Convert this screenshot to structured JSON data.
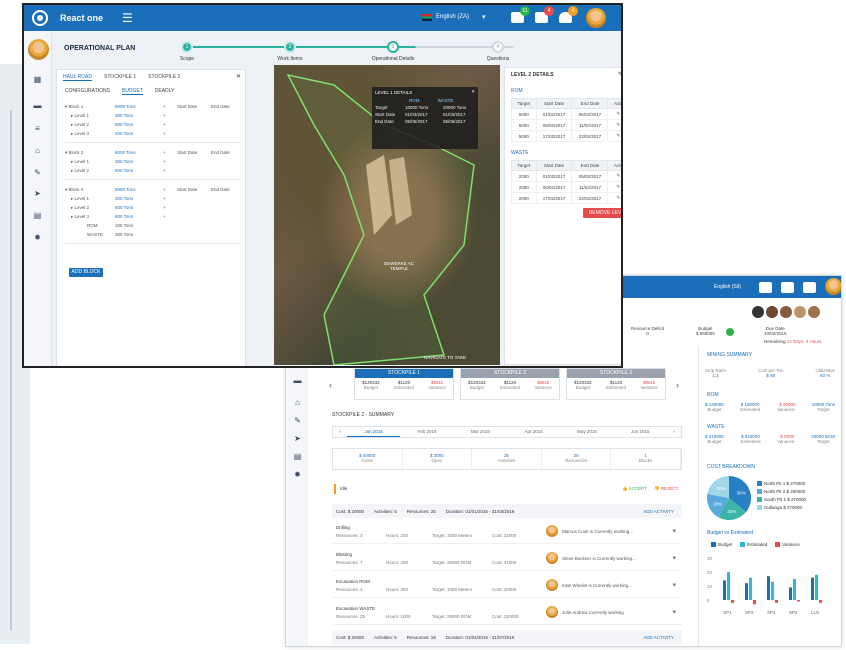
{
  "front": {
    "app_name": "React one",
    "language": "English (ZA)",
    "notifications": [
      {
        "icon": "mail-icon",
        "count": "11",
        "color": "#2bb34b"
      },
      {
        "icon": "chat-icon",
        "count": "4",
        "color": "#e64b4b"
      },
      {
        "icon": "bell-icon",
        "count": "4",
        "color": "#f0a020"
      }
    ],
    "page_title": "OPERATIONAL PLAN",
    "steps": [
      {
        "num": "1",
        "label": "Scope"
      },
      {
        "num": "2",
        "label": "Work Items"
      },
      {
        "num": "3",
        "label": "Operational Details"
      },
      {
        "num": "4",
        "label": "Questions"
      }
    ],
    "left_tabs": [
      "HAUL ROAD",
      "STOCKPILE 1",
      "STOCKPILE 2"
    ],
    "sub_tabs": [
      "CONFIGURATIONS",
      "BUDGET",
      "DEADLY"
    ],
    "blocks": [
      {
        "name": "Block 1",
        "amount": "9000 Tons",
        "start": "Start Date",
        "end": "End Date",
        "levels": [
          {
            "name": "Level 1",
            "amount": "300 Tons"
          },
          {
            "name": "Level 2",
            "amount": "600 Tons"
          },
          {
            "name": "Level 3",
            "amount": "400 Tons"
          }
        ]
      },
      {
        "name": "Block 2",
        "amount": "8000 Tons",
        "start": "Start Date",
        "end": "End Date",
        "levels": [
          {
            "name": "Level 1",
            "amount": "300 Tons"
          },
          {
            "name": "Level 2",
            "amount": "600 Tons"
          }
        ]
      },
      {
        "name": "Block 3",
        "amount": "8000 Tons",
        "start": "Start Date",
        "end": "End Date",
        "levels": [
          {
            "name": "Level 1",
            "amount": "300 Tons"
          },
          {
            "name": "Level 2",
            "amount": "600 Tons"
          },
          {
            "name": "Level 3",
            "amount": "600 Tons"
          }
        ]
      }
    ],
    "sub_levels": [
      {
        "name": "ROM",
        "amount": "100 Tons"
      },
      {
        "name": "WASTE",
        "amount": "300 Tons"
      }
    ],
    "add_block_label": "ADD BLOCK",
    "map": {
      "popup_title": "LEVEL 1 DETAILS",
      "popup_cols": [
        "ROM",
        "WASTE"
      ],
      "popup_rows": [
        {
          "label": "Target",
          "rom": "10000 Tons",
          "waste": "20000 Tons"
        },
        {
          "label": "Start Date",
          "rom": "01/03/2017",
          "waste": "01/03/2017"
        },
        {
          "label": "End Date",
          "rom": "05/05/2017",
          "waste": "05/05/2017"
        }
      ],
      "area_label": "DEWERKE AC",
      "area_sub": "TEMPLE",
      "bottom_label": "NAVIGATE TO TAKE"
    },
    "level_details": {
      "title": "LEVEL 2 DETAILS",
      "rom_label": "ROM",
      "waste_label": "WASTE",
      "headers": [
        "Target",
        "Start Date",
        "End Date",
        "Action"
      ],
      "rom_rows": [
        [
          "5000",
          "01/02/2017",
          "05/02/2017"
        ],
        [
          "5000",
          "06/02/2017",
          "11/02/2017"
        ],
        [
          "5000",
          "17/02/2017",
          "22/02/2017"
        ]
      ],
      "waste_rows": [
        [
          "2000",
          "01/02/2017",
          "05/02/2017"
        ],
        [
          "2000",
          "06/02/2017",
          "11/02/2017"
        ],
        [
          "2000",
          "17/02/2017",
          "22/02/2017"
        ]
      ],
      "remove_label": "REMOVE LEVEL"
    }
  },
  "back": {
    "language": "English (Sit)",
    "kpis": [
      {
        "label": "Resource Deficit",
        "value": "0"
      },
      {
        "label": "Budget",
        "value": "$ 550000"
      },
      {
        "label": "Due Date",
        "value": "10/02/2016"
      },
      {
        "label": "Remaining",
        "value": "12 Days, 4 Hours"
      }
    ],
    "stockpiles": [
      {
        "name": "STOCKPILE 1",
        "color": "#1b6fb8",
        "budget": "$120332",
        "estimated": "$1120",
        "variance": "$961k"
      },
      {
        "name": "STOCKPILE 2",
        "color": "#9aa3ad",
        "budget": "$120332",
        "estimated": "$1120",
        "variance": "$961k"
      },
      {
        "name": "STOCKPILE 3",
        "color": "#9aa3ad",
        "budget": "$120332",
        "estimated": "$1120",
        "variance": "$961k"
      }
    ],
    "stock_value_labels": [
      "Budget",
      "Estimated",
      "Variance"
    ],
    "summary_title": "STOCKPILE 2 - SUMMARY",
    "months": [
      "Jan 2015",
      "Feb 2015",
      "Mar 2015",
      "Apr 2015",
      "May 2015",
      "Jun 2015"
    ],
    "summary_stats": [
      {
        "value": "$ 40000",
        "label": "Costs"
      },
      {
        "value": "$ 3000",
        "label": "Opex"
      },
      {
        "value": "35",
        "label": "Activities"
      },
      {
        "value": "25",
        "label": "Resources"
      },
      {
        "value": "1",
        "label": "Blocks"
      }
    ],
    "state_label": "Idle",
    "approve_label": "ACCEPT",
    "reject_label": "REJECT",
    "cost_bar": {
      "cost": "Cost: $ 20000",
      "activities": "Activities: 5",
      "resources": "Resources: 25",
      "duration": "Duration: 01/01/2016 - 31/03/2016",
      "add": "ADD ACTIVITY"
    },
    "activities": [
      {
        "name": "Drilling",
        "res": "Resources: 3",
        "hours": "Hours: 200",
        "target": "Target: 1000 Meters",
        "cost": "Cost: 32000",
        "msg": "Marcus Cook is Currently working..."
      },
      {
        "name": "Blasting",
        "res": "Resources: 7",
        "hours": "Hours: 200",
        "target": "Target: 25000 ROM",
        "cost": "Cost: 41000",
        "msg": "Steve Buckner is Currently working..."
      },
      {
        "name": "Excavation ROM",
        "res": "Resources: 3",
        "hours": "Hours: 250",
        "target": "Target: 1000 Meters",
        "cost": "Cost: 32000",
        "msg": "Kate Winslet is Currently working..."
      },
      {
        "name": "Excavation WASTE",
        "res": "Resources: 25",
        "hours": "Hours: 1000",
        "target": "Target: 25000 ROM",
        "cost": "Cost: 110000",
        "msg": "Julie Andrew Currently working"
      }
    ],
    "cost_bar2": {
      "cost": "Cost: $ 20000",
      "activities": "Activities: 5",
      "resources": "Resources: 18",
      "duration": "Duration: 01/04/2016 - 31/07/2016",
      "add": "ADD ACTIVITY"
    },
    "right_summary_title": "MINING SUMMARY",
    "right_top": [
      {
        "label": "Strip Ratio",
        "value": "1:2"
      },
      {
        "label": "Cost per Ton",
        "value": "$ 50"
      },
      {
        "label": "Utilization",
        "value": "83 %"
      }
    ],
    "rom_title": "ROM",
    "rom_vals": [
      {
        "value": "$ 140000",
        "label": "Budget"
      },
      {
        "value": "$ 180000",
        "label": "Estimated"
      },
      {
        "value": "- $ 20000",
        "label": "Variance"
      },
      {
        "value": "10000 Tons",
        "label": "Target"
      }
    ],
    "waste_title": "WASTE",
    "waste_vals": [
      {
        "value": "$ 310000",
        "label": "Budget"
      },
      {
        "value": "$ 310000",
        "label": "Estimated"
      },
      {
        "value": "- $ 5000",
        "label": "Variance"
      },
      {
        "value": "20000 BCM",
        "label": "Target"
      }
    ],
    "cost_breakdown_title": "COST BREAKDOWN",
    "pie_legend": [
      {
        "name": "North Pit 1",
        "value": "$ 270000",
        "color": "#2a7fc4"
      },
      {
        "name": "North Pit 2",
        "value": "$ 260000",
        "color": "#5aa9dd"
      },
      {
        "name": "South Pit 1",
        "value": "$ 270000",
        "color": "#3cb4a8"
      },
      {
        "name": "Gullanga",
        "value": "$ 270000",
        "color": "#9fd6e8"
      }
    ],
    "pie_slices": [
      {
        "label": "36%",
        "value": 36,
        "color": "#2a7fc4"
      },
      {
        "label": "22%",
        "value": 22,
        "color": "#3cb4a8"
      },
      {
        "label": "20%",
        "value": 20,
        "color": "#5aa9dd"
      },
      {
        "label": "22%",
        "value": 22,
        "color": "#9fd6e8"
      }
    ],
    "bar_title": "Budget vs Estimated",
    "bar_legend": [
      "Budget",
      "Estimated",
      "Variance"
    ],
    "bar_colors": [
      "#1b6fb8",
      "#2fb7d4",
      "#e64b4b"
    ],
    "bar_categories": [
      "SP1",
      "SP2",
      "SP1",
      "SP2",
      "LU1"
    ],
    "bar_yticks": [
      "30",
      "20",
      "10",
      "0"
    ],
    "bar_values": [
      [
        14,
        20,
        -2
      ],
      [
        12,
        16,
        -3
      ],
      [
        17,
        13,
        -2
      ],
      [
        9,
        15,
        -1
      ],
      [
        16,
        18,
        -2
      ]
    ]
  }
}
